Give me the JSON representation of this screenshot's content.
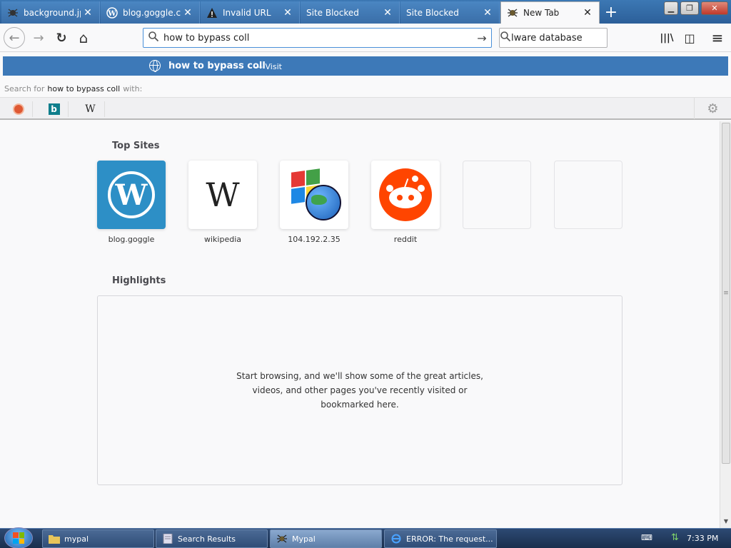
{
  "window": {
    "minimize_label": "▁",
    "maximize_label": "❐",
    "close_label": "✕"
  },
  "tabs": [
    {
      "label": "background.jpg",
      "close": "✕",
      "icon": "spider-icon"
    },
    {
      "label": "blog.goggle.co",
      "close": "✕",
      "icon": "wordpress-icon"
    },
    {
      "label": "Invalid URL",
      "close": "✕",
      "icon": "warning-icon"
    },
    {
      "label": "Site Blocked",
      "close": "✕",
      "icon": "blank-icon"
    },
    {
      "label": "Site Blocked",
      "close": "✕",
      "icon": "blank-icon"
    },
    {
      "label": "New Tab",
      "close": "✕",
      "icon": "spider-icon"
    }
  ],
  "new_tab_label": "+",
  "toolbar": {
    "back": "←",
    "forward": "→",
    "reload": "↻",
    "home": "⌂",
    "go": "→",
    "library": "|||\\",
    "sidebar": "◫",
    "menu": "≡"
  },
  "urlbar": {
    "value": "how to bypass coll"
  },
  "searchbar": {
    "value": "lware database"
  },
  "suggestion": {
    "text": "how to bypass coll",
    "visit": "— Visit"
  },
  "search_with": {
    "prefix": "Search for",
    "query": "how to bypass coll",
    "suffix": "with:"
  },
  "engines": {
    "bing_label": "b",
    "wiki_label": "W",
    "settings": "⚙"
  },
  "top_sites": {
    "title": "Top Sites",
    "sites": [
      {
        "label": "blog.goggle",
        "logo": "W"
      },
      {
        "label": "wikipedia",
        "logo": "W"
      },
      {
        "label": "104.192.2.35",
        "logo": ""
      },
      {
        "label": "reddit",
        "logo": ""
      }
    ]
  },
  "highlights": {
    "title": "Highlights",
    "message": "Start browsing, and we'll show some of the great articles, videos, and other pages you've recently visited or bookmarked here."
  },
  "scrollbar": {
    "grip": "≡",
    "down": "▼"
  },
  "taskbar": {
    "tasks": [
      {
        "label": "mypal"
      },
      {
        "label": "Search Results"
      },
      {
        "label": "Mypal"
      },
      {
        "label": "ERROR: The request..."
      }
    ],
    "keyboard_icon": "⌨",
    "network_icon": "⇅",
    "clock": "7:33 PM"
  },
  "colors": {
    "tab_bar": "#3c78b4",
    "suggestion_bg": "#3d79b8",
    "wordpress": "#2d8fc6",
    "reddit": "#ff4500",
    "taskbar": "#1a2f4d"
  }
}
